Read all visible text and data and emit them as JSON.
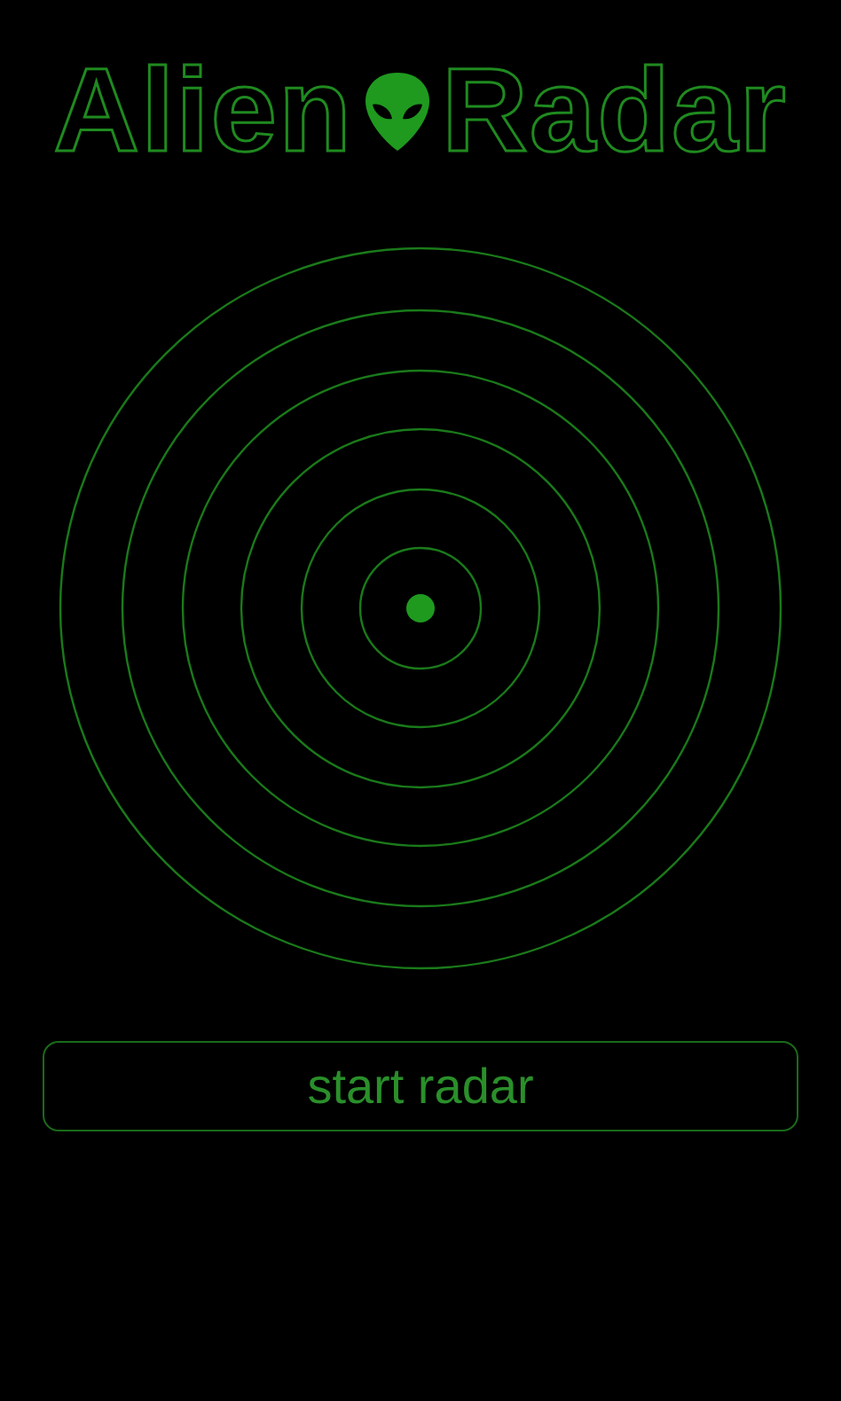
{
  "title": {
    "left": "Alien",
    "right": "Radar"
  },
  "button": {
    "label": "start radar"
  }
}
